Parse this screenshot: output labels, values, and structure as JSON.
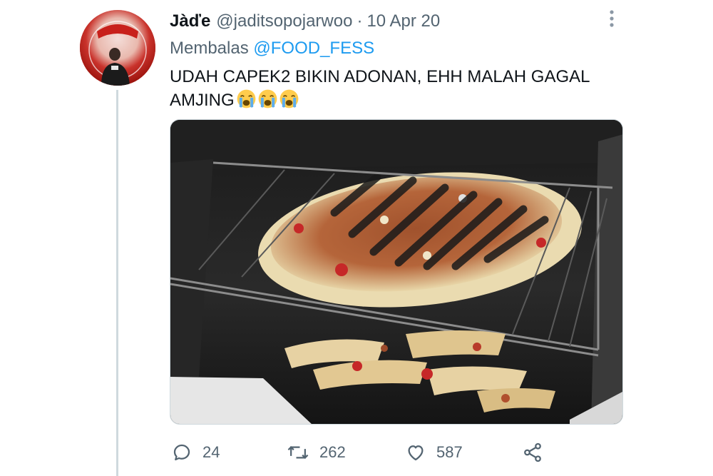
{
  "tweet": {
    "display_name": "Jàďe",
    "handle": "@jaditsopojarwoo",
    "separator": "·",
    "date": "10 Apr 20",
    "reply_prefix": "Membalas",
    "reply_to": "@FOOD_FESS",
    "text": "UDAH CAPEK2 BIKIN ADONAN, EHH MALAH GAGAL AMJING",
    "emoji": [
      "loudly-crying-face",
      "loudly-crying-face",
      "loudly-crying-face"
    ]
  },
  "actions": {
    "reply_count": "24",
    "retweet_count": "262",
    "like_count": "587"
  },
  "colors": {
    "text_primary": "#0f1419",
    "text_secondary": "#536471",
    "link": "#1d9bf0",
    "thread_line": "#cfd9de"
  },
  "icons": [
    "more-icon",
    "reply-icon",
    "retweet-icon",
    "like-icon",
    "share-icon"
  ]
}
